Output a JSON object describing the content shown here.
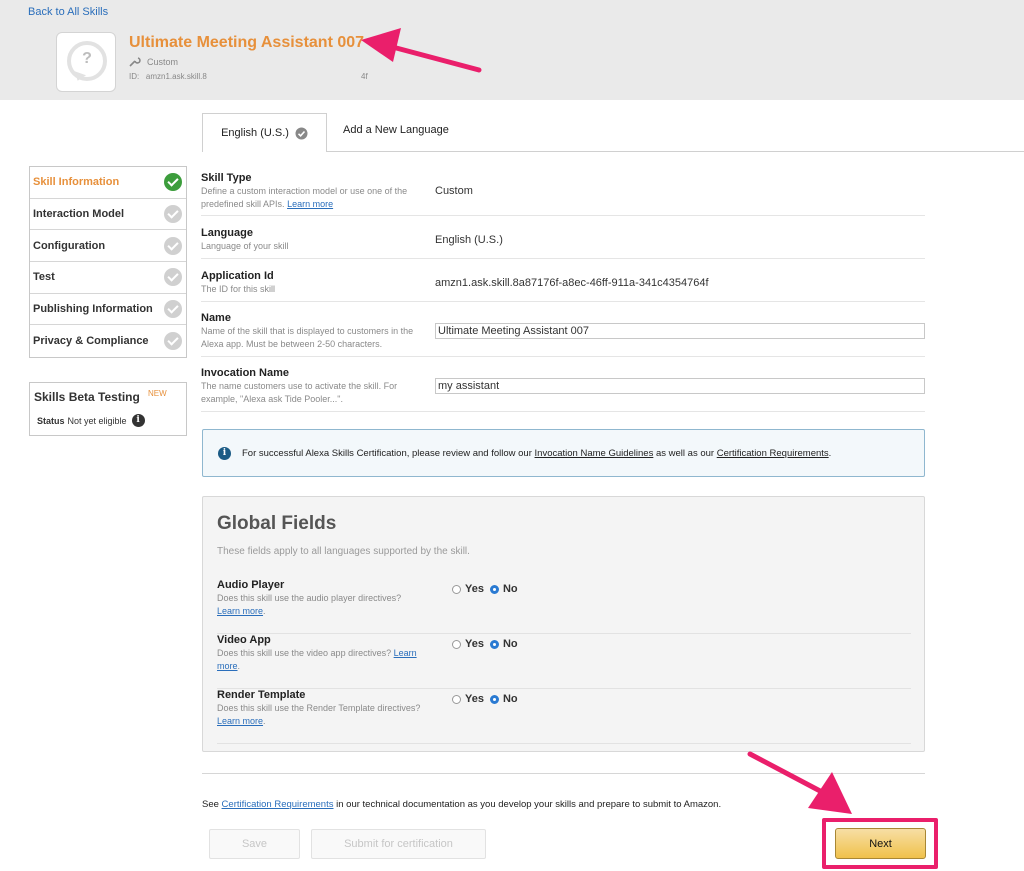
{
  "header": {
    "back_link": "Back to All Skills",
    "skill_title": "Ultimate Meeting Assistant 007",
    "skill_type": "Custom",
    "id_label": "ID:",
    "id_prefix": "amzn1.ask.skill.8",
    "id_suffix": "4f"
  },
  "tabs": {
    "active": "English (U.S.)",
    "add": "Add a New Language"
  },
  "sidebar": {
    "items": [
      {
        "label": "Skill Information",
        "done": true
      },
      {
        "label": "Interaction Model",
        "done": false
      },
      {
        "label": "Configuration",
        "done": false
      },
      {
        "label": "Test",
        "done": false
      },
      {
        "label": "Publishing Information",
        "done": false
      },
      {
        "label": "Privacy & Compliance",
        "done": false
      }
    ],
    "beta": {
      "title": "Skills Beta Testing",
      "badge": "NEW",
      "status_label": "Status",
      "status_value": "Not yet eligible"
    }
  },
  "form": {
    "skill_type": {
      "label": "Skill Type",
      "help": "Define a custom interaction model or use one of the predefined skill APIs.",
      "help_link": "Learn more",
      "value": "Custom"
    },
    "language": {
      "label": "Language",
      "help": "Language of your skill",
      "value": "English (U.S.)"
    },
    "application_id": {
      "label": "Application Id",
      "help": "The ID for this skill",
      "value": "amzn1.ask.skill.8a87176f-a8ec-46ff-911a-341c4354764f"
    },
    "name": {
      "label": "Name",
      "help": "Name of the skill that is displayed to customers in the Alexa app. Must be between 2-50 characters.",
      "value": "Ultimate Meeting Assistant 007"
    },
    "invocation_name": {
      "label": "Invocation Name",
      "help": "The name customers use to activate the skill. For example, \"Alexa ask Tide Pooler...\".",
      "value": "my assistant"
    }
  },
  "notice": {
    "text_before": "For successful Alexa Skills Certification, please review and follow our ",
    "link1": "Invocation Name Guidelines",
    "text_middle": " as well as our ",
    "link2": "Certification Requirements",
    "text_after": "."
  },
  "global_fields": {
    "title": "Global Fields",
    "description": "These fields apply to all languages supported by the skill.",
    "yes_label": "Yes",
    "no_label": "No",
    "rows": [
      {
        "label": "Audio Player",
        "help": "Does this skill use the audio player directives?",
        "link": "Learn more",
        "selected": "No"
      },
      {
        "label": "Video App",
        "help": "Does this skill use the video app directives?",
        "link": "Learn more",
        "selected": "No"
      },
      {
        "label": "Render Template",
        "help": "Does this skill use the Render Template directives?",
        "link": "Learn more",
        "selected": "No"
      }
    ]
  },
  "footer": {
    "see_prefix": "See ",
    "see_link": "Certification Requirements",
    "see_suffix": " in our technical documentation as you develop your skills and prepare to submit to Amazon.",
    "save": "Save",
    "submit": "Submit for certification",
    "next": "Next"
  },
  "colors": {
    "accent_orange": "#e7903b",
    "link_blue": "#2a6ebb",
    "done_green": "#3c9d3c",
    "annotation_pink": "#ea1f6b"
  }
}
